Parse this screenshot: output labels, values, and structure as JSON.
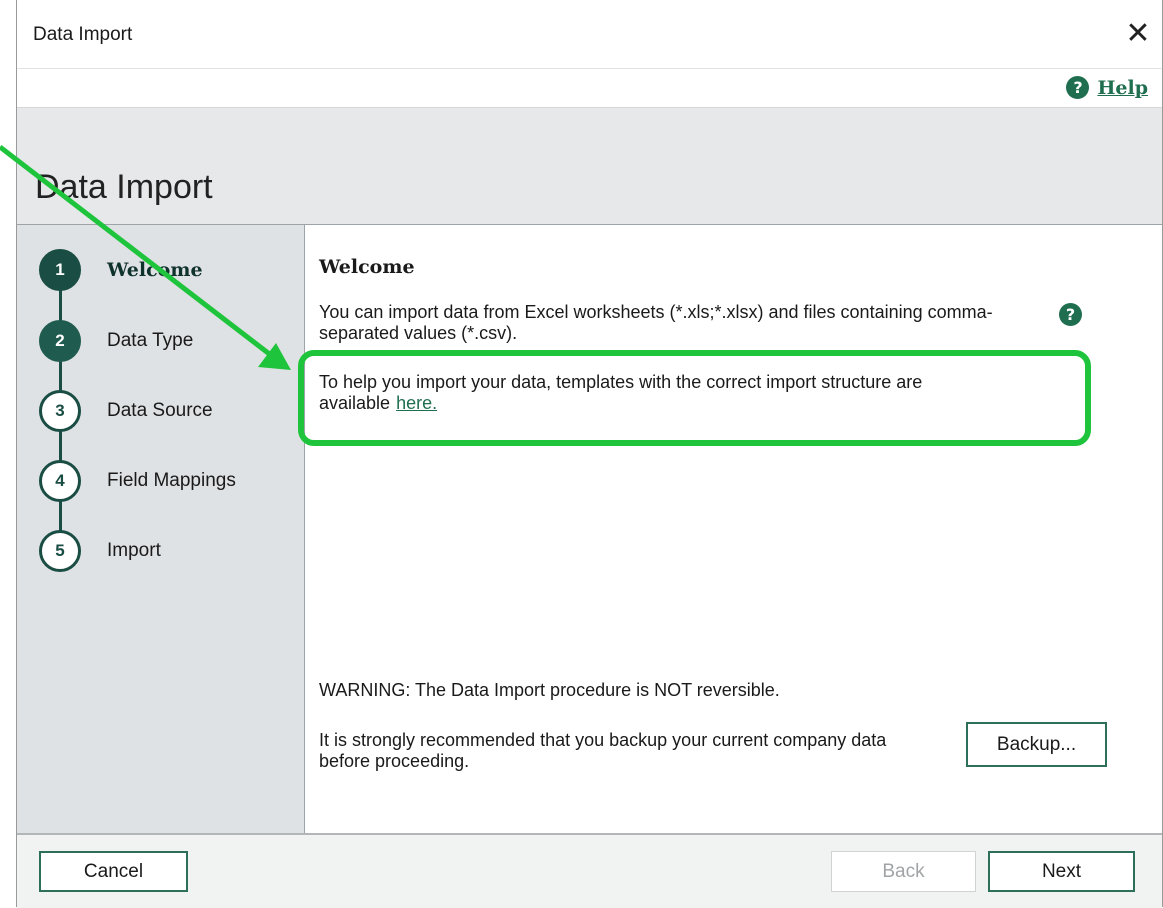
{
  "window": {
    "title": "Data Import",
    "close_glyph": "✕"
  },
  "help": {
    "label": "Help",
    "icon_glyph": "?"
  },
  "header": {
    "title": "Data Import"
  },
  "steps": [
    {
      "number": "1",
      "label": "Welcome",
      "state": "active"
    },
    {
      "number": "2",
      "label": "Data Type",
      "state": "done"
    },
    {
      "number": "3",
      "label": "Data Source",
      "state": "pending"
    },
    {
      "number": "4",
      "label": "Field Mappings",
      "state": "pending"
    },
    {
      "number": "5",
      "label": "Import",
      "state": "pending"
    }
  ],
  "content": {
    "title": "Welcome",
    "intro": "You can import data from Excel worksheets (*.xls;*.xlsx) and files containing comma-separated values (*.csv).",
    "help_icon_glyph": "?",
    "templates_text": "To help you import your data, templates with the correct import structure are available",
    "templates_link": "here.",
    "warning": "WARNING: The Data Import procedure is NOT reversible.",
    "backup_text": "It is strongly recommended that you backup your current company data before proceeding.",
    "backup_button": "Backup..."
  },
  "footer": {
    "cancel": "Cancel",
    "back": "Back",
    "next": "Next"
  },
  "colors": {
    "accent": "#1f6e4f",
    "annotation": "#1ec43b",
    "step_dark": "#1a4d44"
  }
}
